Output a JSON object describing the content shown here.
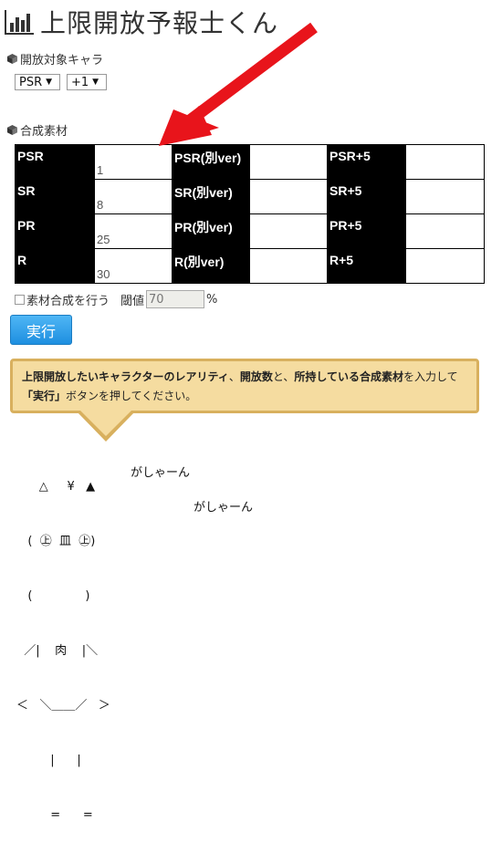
{
  "header": {
    "title": "上限開放予報士くん",
    "icon": "bar-chart-icon"
  },
  "target_section": {
    "label": "開放対象キャラ",
    "rarity_select": "PSR",
    "level_select": "+1"
  },
  "materials_section": {
    "label": "合成素材",
    "rows": [
      [
        {
          "label": "PSR",
          "value": "1"
        },
        {
          "label": "PSR(別ver)",
          "value": ""
        },
        {
          "label": "PSR+5",
          "value": ""
        }
      ],
      [
        {
          "label": "SR",
          "value": "8"
        },
        {
          "label": "SR(別ver)",
          "value": ""
        },
        {
          "label": "SR+5",
          "value": ""
        }
      ],
      [
        {
          "label": "PR",
          "value": "25"
        },
        {
          "label": "PR(別ver)",
          "value": ""
        },
        {
          "label": "PR+5",
          "value": ""
        }
      ],
      [
        {
          "label": "R",
          "value": "30"
        },
        {
          "label": "R(別ver)",
          "value": ""
        },
        {
          "label": "R+5",
          "value": ""
        }
      ]
    ]
  },
  "options": {
    "synth_label": "素材合成を行う",
    "threshold_label": "閾値",
    "threshold_value": "70",
    "threshold_unit": "%"
  },
  "run_button": "実行",
  "message": {
    "p1": "上限開放したいキャラクターのレアリティ",
    "p2": "、",
    "p3": "開放数",
    "p4": "と、",
    "p5": "所持している合成素材",
    "p6": "を入力して",
    "p7": "「実行」",
    "p8": "ボタンを押してください。"
  },
  "ascii_art": {
    "lines": [
      "      △     ¥   ▲",
      "   (  ㊤  皿  ㊤)",
      "   (              )",
      "  ／|    肉    |＼",
      "＜   ＼＿＿／   ＞",
      "         |      |",
      "         =      ="
    ],
    "sfx1": "がしゃーん",
    "sfx2": "がしゃーん"
  },
  "colors": {
    "accent_blue": "#1e8fe0",
    "bubble_bg": "#f5dca0",
    "bubble_border": "#d8b05e",
    "arrow_red": "#e8141b"
  }
}
